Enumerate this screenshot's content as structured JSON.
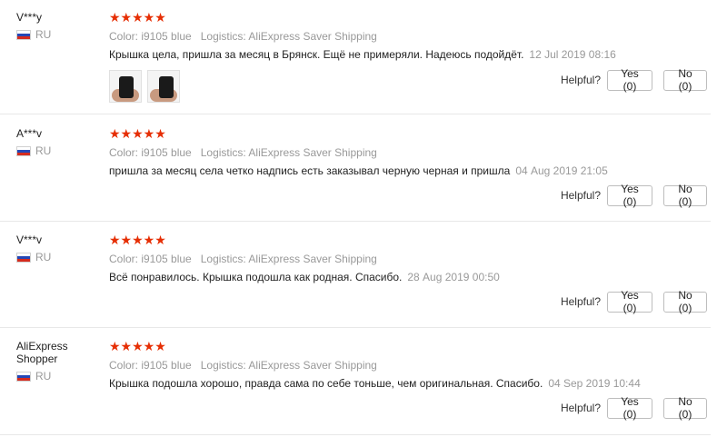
{
  "reviews": [
    {
      "user": "V***y",
      "country": "RU",
      "rating": "★★★★★",
      "color": "Color: i9105 blue",
      "logistics": "Logistics: AliExpress Saver Shipping",
      "text": "Крышка цела, пришла за месяц в Брянск. Ещё не примеряли. Надеюсь подойдёт.",
      "date": "12 Jul 2019 08:16",
      "photos": 2,
      "helpful_label": "Helpful?",
      "yes": "Yes (0)",
      "no": "No (0)"
    },
    {
      "user": "A***v",
      "country": "RU",
      "rating": "★★★★★",
      "color": "Color: i9105 blue",
      "logistics": "Logistics: AliExpress Saver Shipping",
      "text": "пришла за месяц села четко надпись есть заказывал черную черная и пришла",
      "date": "04 Aug 2019 21:05",
      "helpful_label": "Helpful?",
      "yes": "Yes (0)",
      "no": "No (0)"
    },
    {
      "user": "V***v",
      "country": "RU",
      "rating": "★★★★★",
      "color": "Color: i9105 blue",
      "logistics": "Logistics: AliExpress Saver Shipping",
      "text": "Всё понравилось. Крышка подошла как родная. Спасибо.",
      "date": "28 Aug 2019 00:50",
      "helpful_label": "Helpful?",
      "yes": "Yes (0)",
      "no": "No (0)"
    },
    {
      "user": "AliExpress Shopper",
      "country": "RU",
      "rating": "★★★★★",
      "color": "Color: i9105 blue",
      "logistics": "Logistics: AliExpress Saver Shipping",
      "text": "Крышка подошла хорошо, правда сама по себе тоньше, чем оригинальная. Спасибо.",
      "date": "04 Sep 2019 10:44",
      "helpful_label": "Helpful?",
      "yes": "Yes (0)",
      "no": "No (0)"
    }
  ],
  "colors": {
    "stars": "#e62e04",
    "muted": "#999999",
    "divider": "#e8e8e8"
  }
}
